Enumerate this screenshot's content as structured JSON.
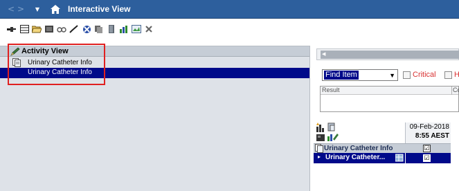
{
  "window": {
    "title": "Interactive View",
    "back_glyph": "<",
    "forward_glyph": ">",
    "dropdown_glyph": "▼",
    "home_icon": "home-icon"
  },
  "toolbar": {
    "icons": [
      "flowsheet-icon",
      "table-icon",
      "folder-open-icon",
      "document-icon",
      "glasses-icon",
      "sign-check-icon",
      "block-icon",
      "pages-icon",
      "book-icon",
      "chart-icon",
      "image-icon",
      "close-x-icon"
    ]
  },
  "activity_view": {
    "header": "Activity View",
    "rows": [
      {
        "label": "Urinary Catheter Info",
        "selected": false
      },
      {
        "label": "Urinary Catheter Info",
        "selected": true
      }
    ]
  },
  "right_panel": {
    "find_select": {
      "value": "Find Item",
      "arrow": "▼"
    },
    "filters": [
      {
        "label": "Critical",
        "checked": false
      },
      {
        "label": "H",
        "checked": false
      }
    ],
    "result_table": {
      "col1": "Result",
      "col2": "Co"
    },
    "grid": {
      "date": "09-Feb-2018",
      "time": "8:55 AEST",
      "category": {
        "label": "Urinary Catheter Info",
        "check": "☑"
      },
      "selected_item": {
        "label": "Urinary Catheter...",
        "check": "☑"
      }
    }
  },
  "colors": {
    "titlebar": "#2d5f9d",
    "selection": "#000a8a",
    "highlight_box": "#e02020",
    "filter_text": "#d83232"
  }
}
